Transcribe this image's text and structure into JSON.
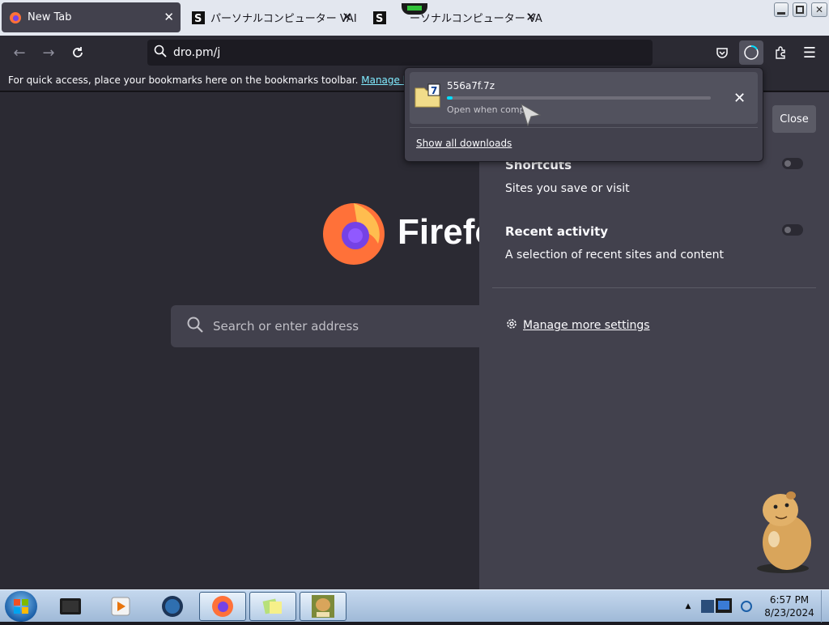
{
  "tabs": [
    {
      "label": "New Tab",
      "active": true,
      "icon": "firefox-icon"
    },
    {
      "label": "パーソナルコンピューター VAI",
      "active": false,
      "icon": "s-site-icon"
    },
    {
      "label": "ーソナルコンピューター VAI",
      "active": false,
      "icon": "s-site-icon"
    }
  ],
  "nav": {
    "url": "dro.pm/j"
  },
  "bookmarks_bar": {
    "message": "For quick access, place your bookmarks here on the bookmarks toolbar.",
    "link": "Manage bookmarks..."
  },
  "newtab": {
    "brand": "Firefo",
    "search_placeholder": "Search or enter address"
  },
  "panel": {
    "close_label": "Close",
    "shortcuts_title": "Shortcuts",
    "shortcuts_desc": "Sites you save or visit",
    "recent_title": "Recent activity",
    "recent_desc": "A selection of recent sites and content",
    "manage_label": "Manage more settings"
  },
  "downloads": {
    "filename": "556a7f.7z",
    "status": "Open when comp",
    "progress": 0.02,
    "show_all": "Show all downloads"
  },
  "taskbar": {
    "time": "6:57 PM",
    "date": "8/23/2024"
  },
  "colors": {
    "accent": "#00ddff",
    "link": "#80ebff",
    "page_bg": "#2b2a33",
    "panel_bg": "#42414d"
  }
}
